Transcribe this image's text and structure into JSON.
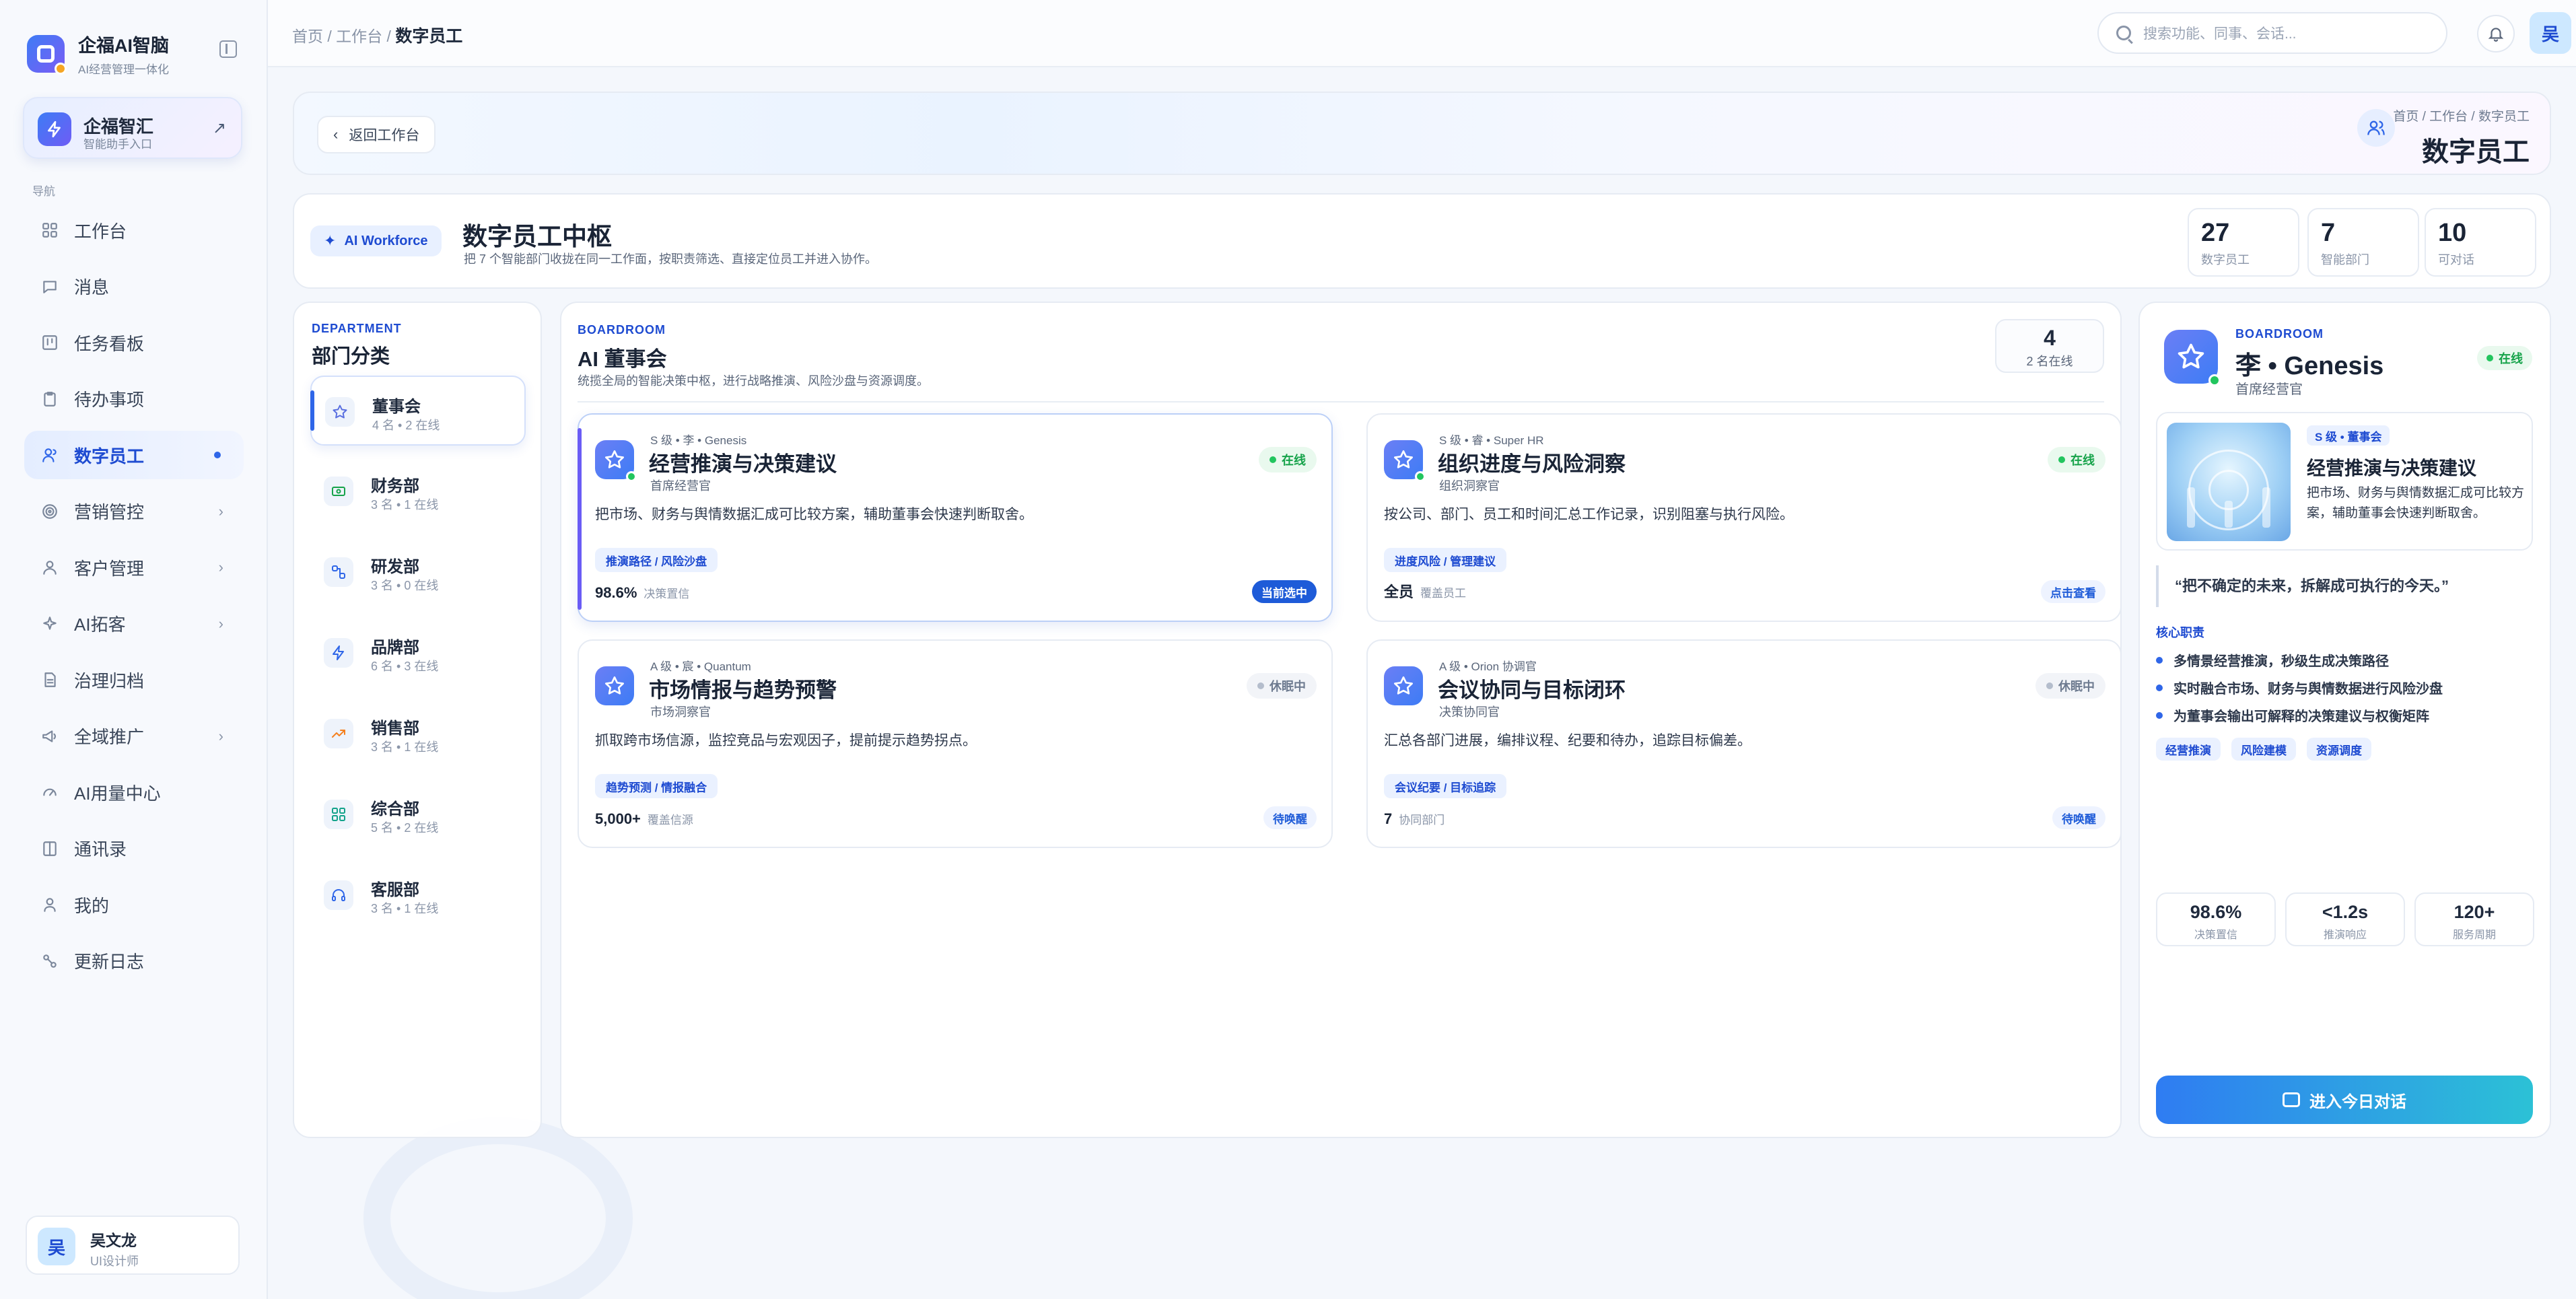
{
  "sidebar": {
    "brand_title": "企福AI智脑",
    "brand_sub": "AI经营管理一体化",
    "assist_title": "企福智汇",
    "assist_sub": "智能助手入口",
    "nav_heading": "导航",
    "items": [
      {
        "label": "工作台",
        "icon": "grid-icon"
      },
      {
        "label": "消息",
        "icon": "message-icon"
      },
      {
        "label": "任务看板",
        "icon": "kanban-icon"
      },
      {
        "label": "待办事项",
        "icon": "clipboard-icon"
      },
      {
        "label": "数字员工",
        "icon": "user-icon",
        "active": true
      },
      {
        "label": "营销管控",
        "icon": "target-icon",
        "chevron": true
      },
      {
        "label": "客户管理",
        "icon": "person-icon",
        "chevron": true
      },
      {
        "label": "AI拓客",
        "icon": "sparkle-icon",
        "chevron": true
      },
      {
        "label": "治理归档",
        "icon": "document-icon"
      },
      {
        "label": "全域推广",
        "icon": "megaphone-icon",
        "chevron": true
      },
      {
        "label": "AI用量中心",
        "icon": "gauge-icon"
      },
      {
        "label": "通讯录",
        "icon": "book-icon"
      },
      {
        "label": "我的",
        "icon": "profile-icon"
      },
      {
        "label": "更新日志",
        "icon": "changelog-icon"
      }
    ],
    "user": {
      "avatar": "吴",
      "name": "吴文龙",
      "role": "UI设计师"
    }
  },
  "topbar": {
    "crumb_prefix": "首页 / 工作台 / ",
    "crumb_current": "数字员工",
    "search_placeholder": "搜索功能、同事、会话...",
    "avatar": "吴"
  },
  "header": {
    "back_label": "返回工作台",
    "crumb": "首页 / 工作台 / 数字员工",
    "title": "数字员工"
  },
  "hub": {
    "pill": "AI Workforce",
    "title": "数字员工中枢",
    "subtitle": "把 7 个智能部门收拢在同一工作面，按职责筛选、直接定位员工并进入协作。",
    "stats": [
      {
        "value": "27",
        "label": "数字员工"
      },
      {
        "value": "7",
        "label": "智能部门"
      },
      {
        "value": "10",
        "label": "可对话"
      }
    ]
  },
  "departments": {
    "tag": "DEPARTMENT",
    "title": "部门分类",
    "items": [
      {
        "name": "董事会",
        "meta": "4 名 • 2 在线",
        "icon": "star-icon",
        "color": "#5a6fe0",
        "active": true
      },
      {
        "name": "财务部",
        "meta": "3 名 • 1 在线",
        "icon": "money-icon",
        "color": "#16a34a"
      },
      {
        "name": "研发部",
        "meta": "3 名 • 0 在线",
        "icon": "flow-icon",
        "color": "#2f66e8"
      },
      {
        "name": "品牌部",
        "meta": "6 名 • 3 在线",
        "icon": "bolt-icon",
        "color": "#2f66e8"
      },
      {
        "name": "销售部",
        "meta": "3 名 • 1 在线",
        "icon": "trend-icon",
        "color": "#f5801f"
      },
      {
        "name": "综合部",
        "meta": "5 名 • 2 在线",
        "icon": "grid-icon",
        "color": "#14a38b"
      },
      {
        "name": "客服部",
        "meta": "3 名 • 1 在线",
        "icon": "headset-icon",
        "color": "#2f66e8"
      }
    ]
  },
  "board": {
    "tag": "BOARDROOM",
    "title": "AI 董事会",
    "subtitle": "统揽全局的智能决策中枢，进行战略推演、风险沙盘与资源调度。",
    "count": "4",
    "count_label": "2 名在线",
    "cards": [
      {
        "tier": "S 级 • 李 • Genesis",
        "title": "经营推演与决策建议",
        "role": "首席经营官",
        "status": "在线",
        "online": true,
        "desc": "把市场、财务与舆情数据汇成可比较方案，辅助董事会快速判断取舍。",
        "tag": "推演路径 / 风险沙盘",
        "metric": "98.6%",
        "metric_label": "决策置信",
        "action": "当前选中",
        "selected": true
      },
      {
        "tier": "S 级 • 睿 • Super HR",
        "title": "组织进度与风险洞察",
        "role": "组织洞察官",
        "status": "在线",
        "online": true,
        "desc": "按公司、部门、员工和时间汇总工作记录，识别阻塞与执行风险。",
        "tag": "进度风险 / 管理建议",
        "metric": "全员",
        "metric_label": "覆盖员工",
        "action": "点击查看"
      },
      {
        "tier": "A 级 • 宸 • Quantum",
        "title": "市场情报与趋势预警",
        "role": "市场洞察官",
        "status": "休眠中",
        "online": false,
        "desc": "抓取跨市场信源，监控竞品与宏观因子，提前提示趋势拐点。",
        "tag": "趋势预测 / 情报融合",
        "metric": "5,000+",
        "metric_label": "覆盖信源",
        "action": "待唤醒"
      },
      {
        "tier": "A 级 • Orion 协调官",
        "title": "会议协同与目标闭环",
        "role": "决策协同官",
        "status": "休眠中",
        "online": false,
        "desc": "汇总各部门进展，编排议程、纪要和待办，追踪目标偏差。",
        "tag": "会议纪要 / 目标追踪",
        "metric": "7",
        "metric_label": "协同部门",
        "action": "待唤醒"
      }
    ]
  },
  "detail": {
    "tag": "BOARDROOM",
    "name": "李 • Genesis",
    "role": "首席经营官",
    "status": "在线",
    "tier": "S 级 • 董事会",
    "title": "经营推演与决策建议",
    "desc": "把市场、财务与舆情数据汇成可比较方案，辅助董事会快速判断取舍。",
    "quote": "“把不确定的未来，拆解成可执行的今天。”",
    "section": "核心职责",
    "duties": [
      "多情景经营推演，秒级生成决策路径",
      "实时融合市场、财务与舆情数据进行风险沙盘",
      "为董事会输出可解释的决策建议与权衡矩阵"
    ],
    "tags": [
      "经营推演",
      "风险建模",
      "资源调度"
    ],
    "stats": [
      {
        "value": "98.6%",
        "label": "决策置信"
      },
      {
        "value": "<1.2s",
        "label": "推演响应"
      },
      {
        "value": "120+",
        "label": "服务周期"
      }
    ],
    "cta": "进入今日对话"
  },
  "colors": {
    "accent": "#2f66e8",
    "online": "#22c55e",
    "brand_purple": "#6a5cf5"
  }
}
